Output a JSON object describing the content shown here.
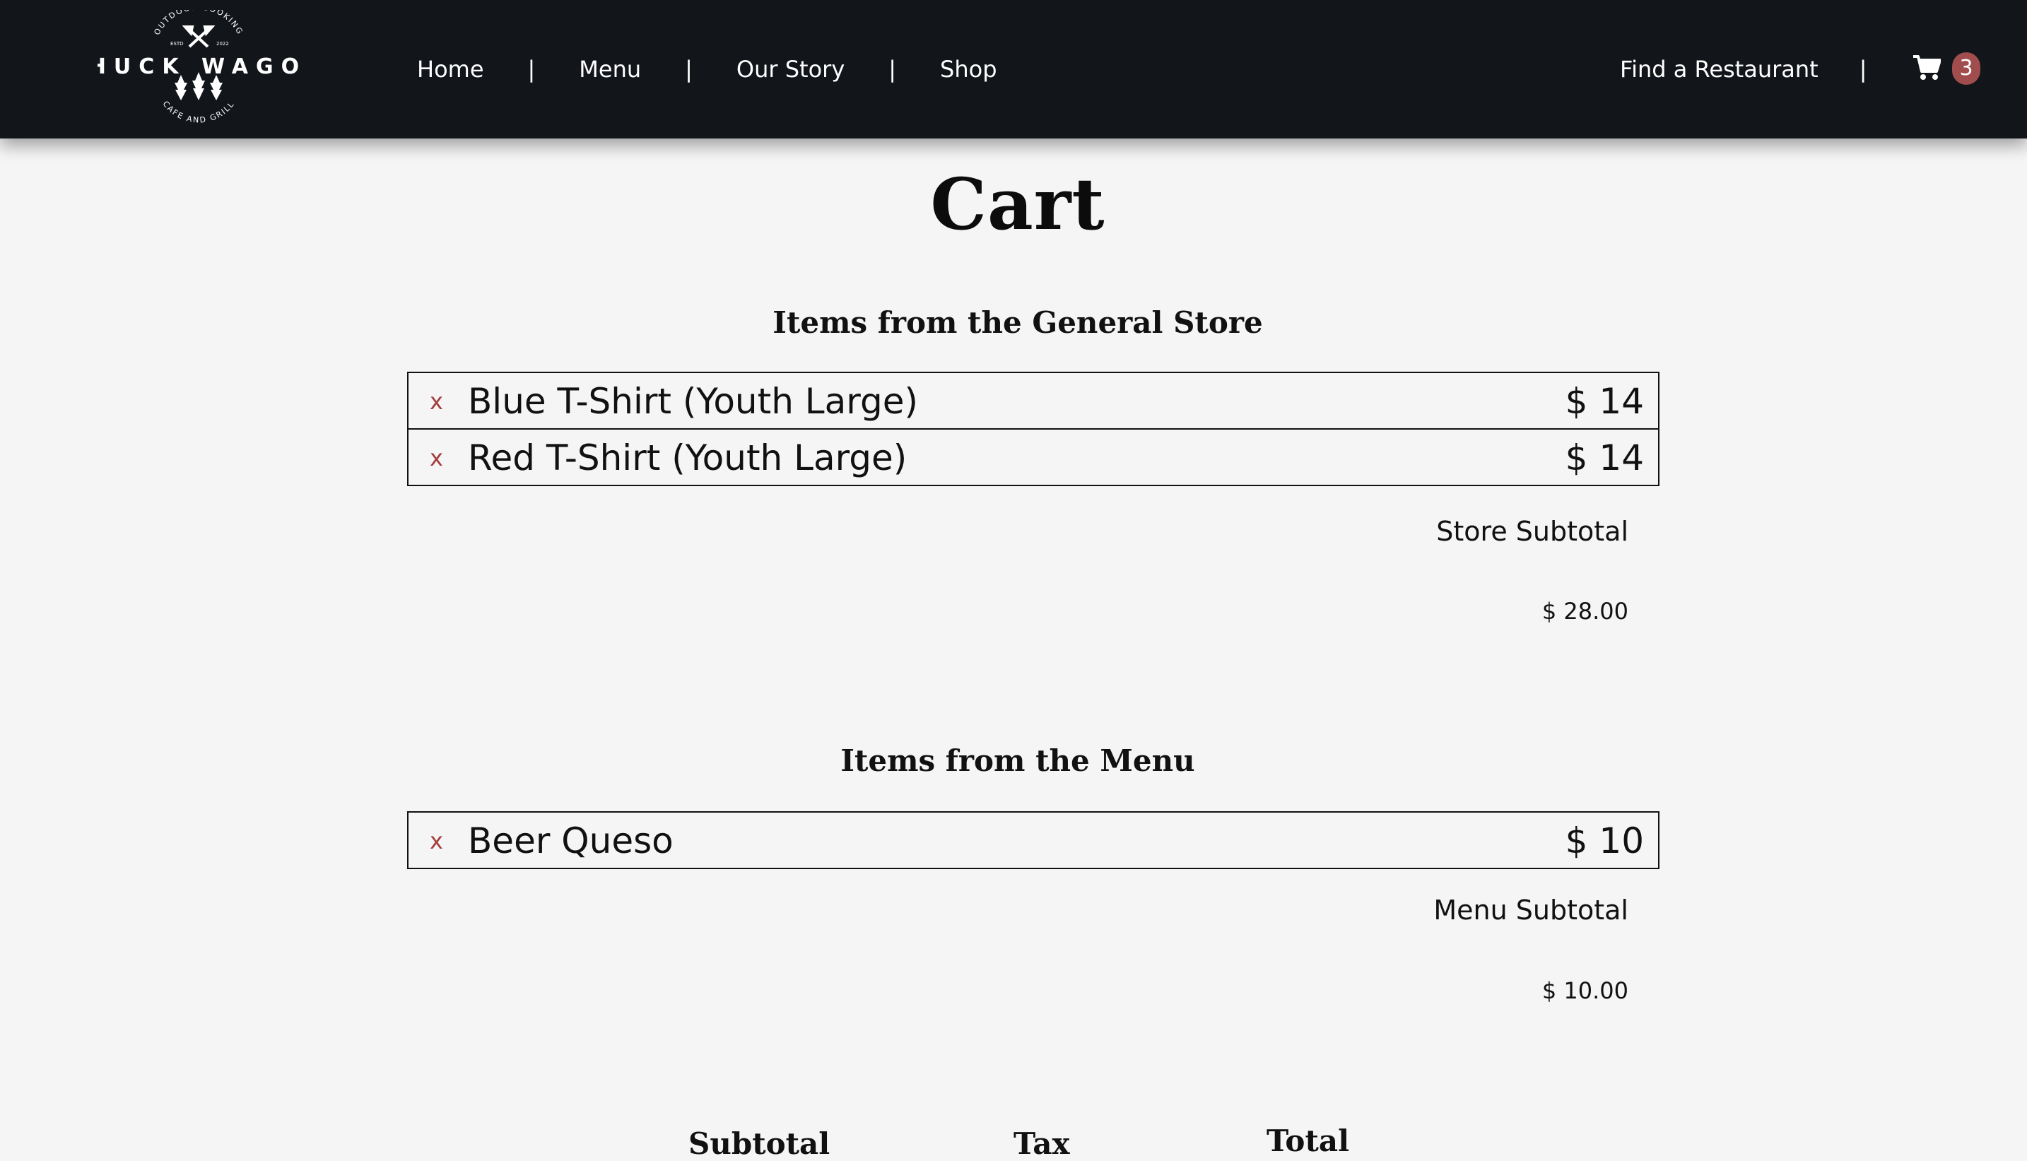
{
  "brand": {
    "top_text": "OUTDOOR COOKING",
    "estd_left": "ESTD",
    "estd_right": "2022",
    "name": "CHUCK WAGON",
    "bottom_text": "CAFE AND GRILL"
  },
  "nav": {
    "links": [
      "Home",
      "Menu",
      "Our Story",
      "Shop"
    ],
    "separator": "|",
    "find_restaurant": "Find a Restaurant",
    "cart_count": "3"
  },
  "page": {
    "title": "Cart"
  },
  "store_section": {
    "heading": "Items from the General Store",
    "items": [
      {
        "remove": "x",
        "name": "Blue T-Shirt (Youth Large)",
        "price": "$ 14"
      },
      {
        "remove": "x",
        "name": "Red T-Shirt (Youth Large)",
        "price": "$ 14"
      }
    ],
    "subtotal_label": "Store Subtotal",
    "subtotal_value": "$ 28.00"
  },
  "menu_section": {
    "heading": "Items from the Menu",
    "items": [
      {
        "remove": "x",
        "name": "Beer Queso",
        "price": "$ 10"
      }
    ],
    "subtotal_label": "Menu Subtotal",
    "subtotal_value": "$ 10.00"
  },
  "summary": {
    "subtotal_heading": "Subtotal",
    "tax_heading": "Tax",
    "total_heading": "Total"
  },
  "colors": {
    "nav_bg": "#12151a",
    "accent": "#a14d4d",
    "remove_x": "#a33c3c",
    "page_bg": "#f5f5f5"
  },
  "icons": [
    "cart-icon",
    "crossed-axes-icon",
    "pine-trees-icon"
  ]
}
